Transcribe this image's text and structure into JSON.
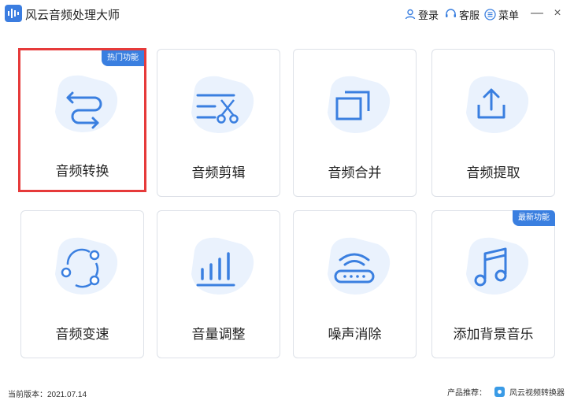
{
  "app": {
    "title": "风云音频处理大师"
  },
  "toolbar": {
    "login": "登录",
    "service": "客服",
    "menu": "菜单",
    "minimize": "—",
    "close": "×"
  },
  "cards": [
    {
      "label": "音频转换",
      "icon": "convert-arrows-icon",
      "badge": "热门功能",
      "selected": true
    },
    {
      "label": "音频剪辑",
      "icon": "scissors-cut-icon",
      "badge": ""
    },
    {
      "label": "音频合并",
      "icon": "merge-windows-icon",
      "badge": ""
    },
    {
      "label": "音频提取",
      "icon": "extract-upload-icon",
      "badge": ""
    },
    {
      "label": "音频变速",
      "icon": "speed-circle-icon",
      "badge": ""
    },
    {
      "label": "音量调整",
      "icon": "volume-bars-icon",
      "badge": ""
    },
    {
      "label": "噪声消除",
      "icon": "noise-router-icon",
      "badge": ""
    },
    {
      "label": "添加背景音乐",
      "icon": "music-note-icon",
      "badge": "最新功能"
    }
  ],
  "footer": {
    "version": "当前版本：2021.07.14",
    "recommend_label": "产品推荐：",
    "recommend_product": "风云视频转换器"
  },
  "colors": {
    "accent": "#3a7fe0",
    "blob": "#eaf2fd",
    "selected_border": "#e63a3a"
  }
}
